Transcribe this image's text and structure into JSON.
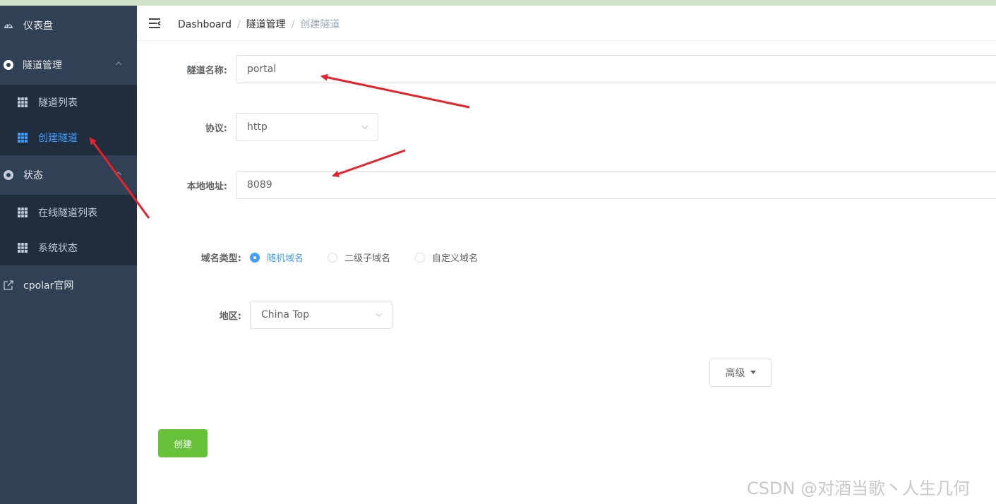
{
  "sidebar": {
    "items": [
      {
        "label": "仪表盘",
        "icon": "dashboard-icon"
      },
      {
        "label": "隧道管理",
        "icon": "tunnel-icon"
      },
      {
        "label": "隧道列表",
        "icon": "grid-icon"
      },
      {
        "label": "创建隧道",
        "icon": "grid-icon"
      },
      {
        "label": "状态",
        "icon": "status-icon"
      },
      {
        "label": "在线隧道列表",
        "icon": "grid-icon"
      },
      {
        "label": "系统状态",
        "icon": "grid-icon"
      },
      {
        "label": "cpolar官网",
        "icon": "external-link-icon"
      }
    ]
  },
  "header": {
    "breadcrumb": [
      "Dashboard",
      "隧道管理",
      "创建隧道"
    ],
    "separator": "/"
  },
  "form": {
    "name_label": "隧道名称:",
    "name_value": "portal",
    "protocol_label": "协议:",
    "protocol_value": "http",
    "local_label": "本地地址:",
    "local_value": "8089",
    "domain_type_label": "域名类型:",
    "domain_options": [
      "随机域名",
      "二级子域名",
      "自定义域名"
    ],
    "domain_selected": "随机域名",
    "region_label": "地区:",
    "region_value": "China Top",
    "advanced_label": "高级",
    "create_label": "创建"
  },
  "watermark": "CSDN @对酒当歌丶人生几何",
  "colors": {
    "sidebar_bg": "#304156",
    "submenu_bg": "#1f2d3d",
    "active": "#409eff",
    "create_button": "#67c23a",
    "annotation_arrow": "#e8222a"
  }
}
